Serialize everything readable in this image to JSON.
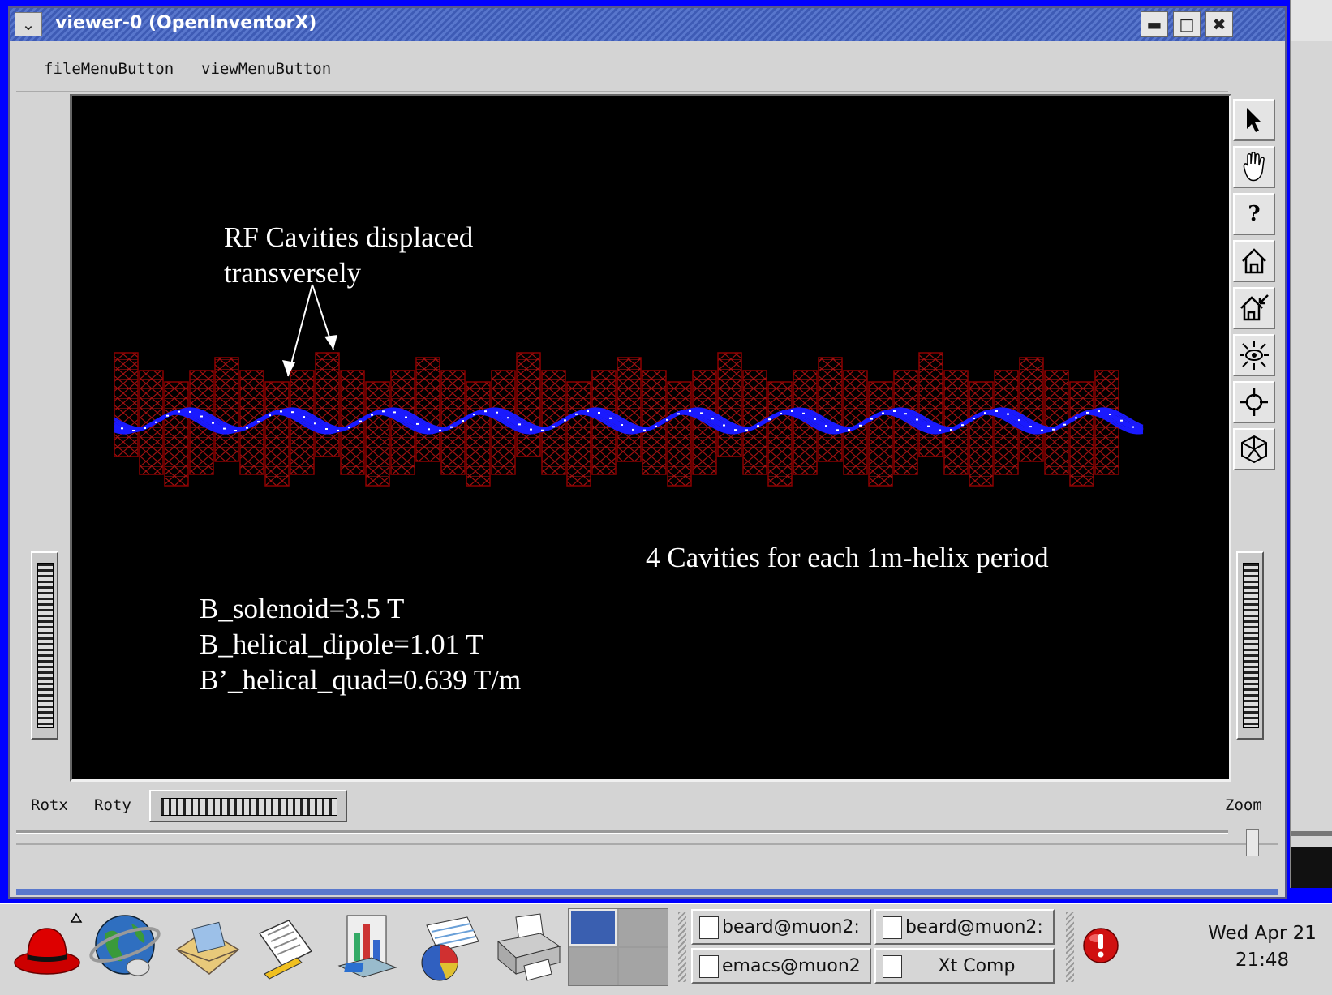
{
  "window": {
    "title": "viewer-0 (OpenInventorX)",
    "menu": [
      "fileMenuButton",
      "viewMenuButton"
    ],
    "title_buttons": [
      "minimize",
      "maximize",
      "close"
    ]
  },
  "viewer": {
    "annotations": {
      "rf_label": "RF Cavities displaced\ntransversely",
      "cavities_label": "4 Cavities for each 1m-helix period",
      "params": "B_solenoid=3.5 T\nB_helical_dipole=1.01 T\nB’_helical_quad=0.639 T/m"
    },
    "colors": {
      "background": "#000000",
      "cavity": "#8b0000",
      "beam": "#1a1aff",
      "beam_highlight": "#ffffff"
    },
    "tools": [
      "pick-arrow-icon",
      "pan-hand-icon",
      "help-icon",
      "home-icon",
      "set-home-icon",
      "view-all-icon",
      "seek-icon",
      "projection-icon"
    ]
  },
  "controls": {
    "rotx": "Rotx",
    "roty": "Roty",
    "zoom": "Zoom"
  },
  "taskbar": {
    "launchers": [
      "redhat-menu-icon",
      "web-browser-icon",
      "email-icon",
      "writer-icon",
      "presentation-icon",
      "spreadsheet-icon",
      "printer-icon"
    ],
    "tasks": [
      "beard@muon2:",
      "beard@muon2:",
      "emacs@muon2",
      "Xt Comp"
    ],
    "clock": {
      "date": "Wed Apr 21",
      "time": "21:48"
    }
  }
}
